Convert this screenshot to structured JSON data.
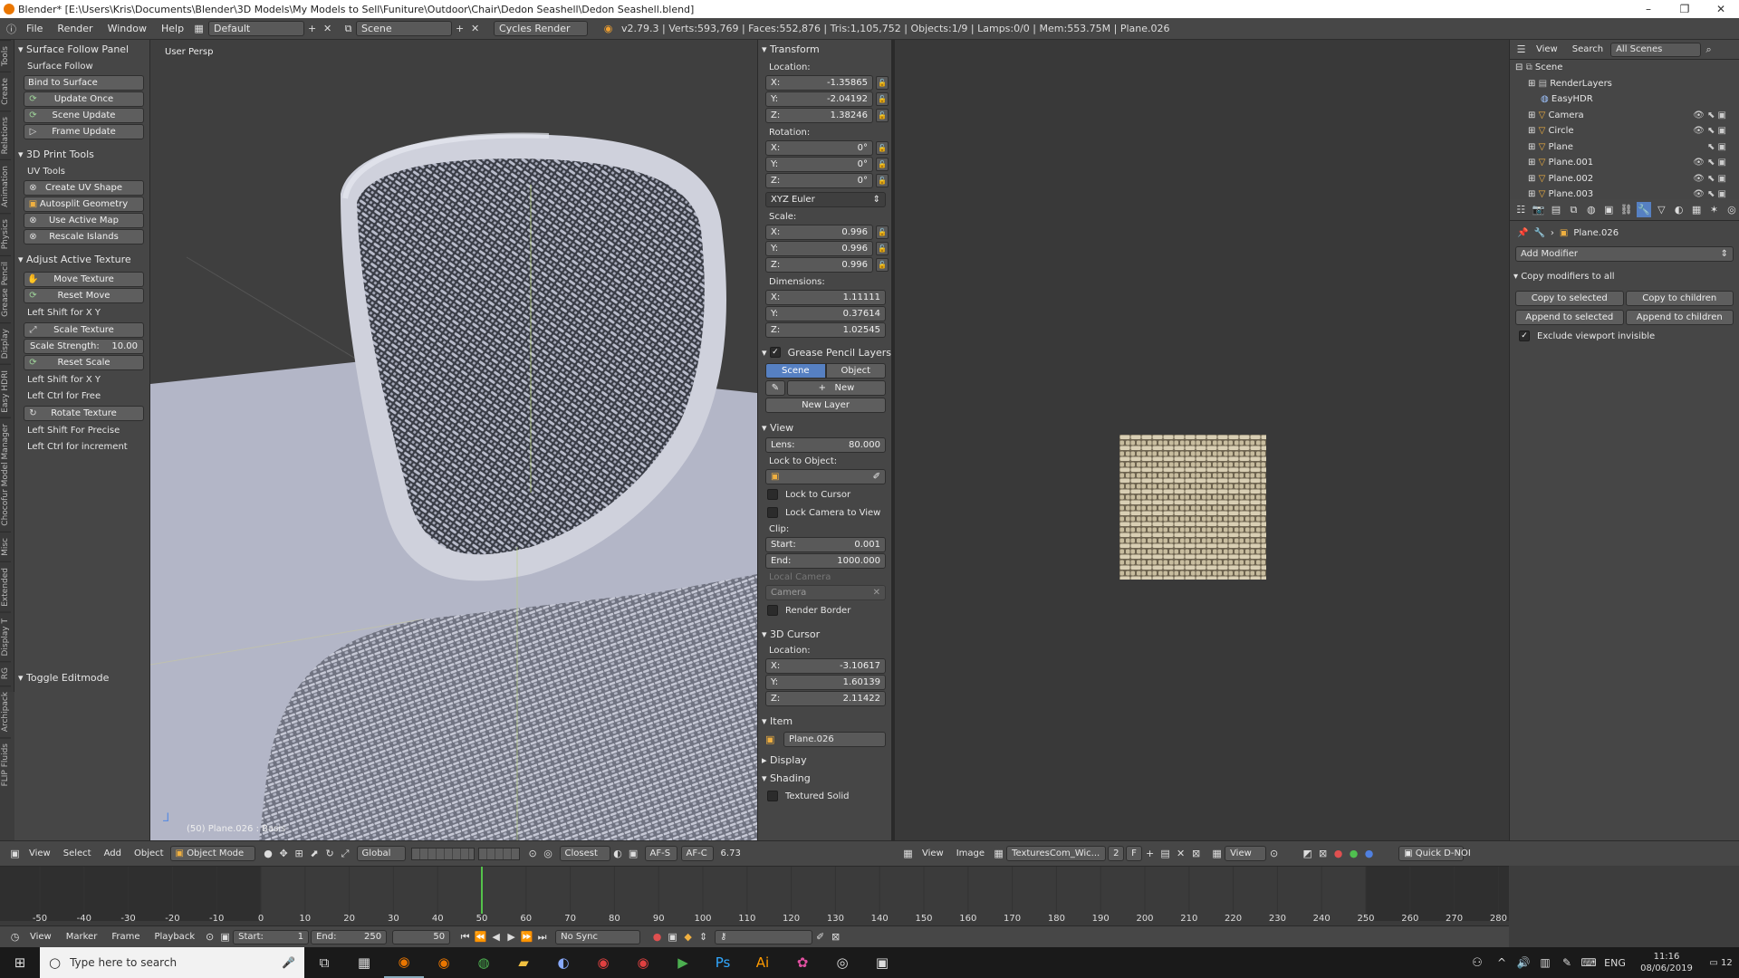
{
  "titlebar": {
    "title": "Blender* [E:\\Users\\Kris\\Documents\\Blender\\3D Models\\My Models to Sell\\Funiture\\Outdoor\\Chair\\Dedon Seashell\\Dedon Seashell.blend]",
    "min": "–",
    "max": "❐",
    "close": "✕"
  },
  "menubar": {
    "items": [
      "File",
      "Render",
      "Window",
      "Help"
    ],
    "layout": "Default",
    "scene": "Scene",
    "engine": "Cycles Render",
    "stats": "v2.79.3 | Verts:593,769 | Faces:552,876 | Tris:1,105,752 | Objects:1/9 | Lamps:0/0 | Mem:553.75M | Plane.026"
  },
  "vtabs": [
    "Tools",
    "Create",
    "Relations",
    "Animation",
    "Physics",
    "Grease Pencil",
    "Display",
    "Easy HDRI",
    "Chocofur Model Manager",
    "Misc",
    "Extended",
    "Display T",
    "RG",
    "Archipack",
    "FLIP Fluids"
  ],
  "toolshelf": {
    "surface_follow": {
      "header": "Surface Follow Panel",
      "label": "Surface Follow",
      "bind": "Bind to Surface",
      "update_once": "Update Once",
      "scene_update": "Scene Update",
      "frame_update": "Frame Update"
    },
    "print3d": {
      "header": "3D Print Tools",
      "uv_label": "UV Tools",
      "create_uv": "Create UV Shape",
      "autosplit": "Autosplit Geometry",
      "use_active_map": "Use Active Map",
      "rescale": "Rescale Islands"
    },
    "adjust": {
      "header": "Adjust Active Texture",
      "move": "Move Texture",
      "reset_move": "Reset Move",
      "hint1": "Left Shift for X Y",
      "scale": "Scale Texture",
      "strength_label": "Scale Strength:",
      "strength_value": "10.00",
      "reset_scale": "Reset Scale",
      "hint2": "Left Shift for X Y",
      "hint3": "Left Ctrl for Free",
      "rotate": "Rotate Texture",
      "hint4": "Left Shift For Precise",
      "hint5": "Left Ctrl for increment"
    },
    "toggle_editmode": "Toggle Editmode"
  },
  "viewport": {
    "label": "User Persp",
    "status": "(50) Plane.026 : Basis"
  },
  "npanel": {
    "transform": {
      "header": "Transform",
      "location_label": "Location:",
      "loc": [
        {
          "k": "X:",
          "v": "-1.35865"
        },
        {
          "k": "Y:",
          "v": "-2.04192"
        },
        {
          "k": "Z:",
          "v": "1.38246"
        }
      ],
      "rotation_label": "Rotation:",
      "rot": [
        {
          "k": "X:",
          "v": "0°"
        },
        {
          "k": "Y:",
          "v": "0°"
        },
        {
          "k": "Z:",
          "v": "0°"
        }
      ],
      "rotmode": "XYZ Euler",
      "scale_label": "Scale:",
      "scale": [
        {
          "k": "X:",
          "v": "0.996"
        },
        {
          "k": "Y:",
          "v": "0.996"
        },
        {
          "k": "Z:",
          "v": "0.996"
        }
      ],
      "dim_label": "Dimensions:",
      "dim": [
        {
          "k": "X:",
          "v": "1.11111"
        },
        {
          "k": "Y:",
          "v": "0.37614"
        },
        {
          "k": "Z:",
          "v": "1.02545"
        }
      ]
    },
    "grease": {
      "header": "Grease Pencil Layers",
      "scene_tab": "Scene",
      "object_tab": "Object",
      "new": "New",
      "new_layer": "New Layer"
    },
    "view": {
      "header": "View",
      "lens_label": "Lens:",
      "lens": "80.000",
      "lock_label": "Lock to Object:",
      "lock_cursor": "Lock to Cursor",
      "lock_camera": "Lock Camera to View",
      "clip_label": "Clip:",
      "start_label": "Start:",
      "start": "0.001",
      "end_label": "End:",
      "end": "1000.000",
      "local_camera": "Local Camera",
      "camera": "Camera",
      "render_border": "Render Border"
    },
    "cursor": {
      "header": "3D Cursor",
      "location_label": "Location:",
      "loc": [
        {
          "k": "X:",
          "v": "-3.10617"
        },
        {
          "k": "Y:",
          "v": "1.60139"
        },
        {
          "k": "Z:",
          "v": "2.11422"
        }
      ]
    },
    "item": {
      "header": "Item",
      "name": "Plane.026"
    },
    "display_header": "Display",
    "shading_header": "Shading",
    "textured_solid": "Textured Solid"
  },
  "outliner": {
    "view": "View",
    "search": "Search",
    "scenes": "All Scenes",
    "rows": [
      {
        "name": "Scene",
        "indent": 0
      },
      {
        "name": "RenderLayers",
        "indent": 1
      },
      {
        "name": "EasyHDR",
        "indent": 1
      },
      {
        "name": "Camera",
        "indent": 1
      },
      {
        "name": "Circle",
        "indent": 1
      },
      {
        "name": "Plane",
        "indent": 1
      },
      {
        "name": "Plane.001",
        "indent": 1
      },
      {
        "name": "Plane.002",
        "indent": 1
      },
      {
        "name": "Plane.003",
        "indent": 1
      }
    ]
  },
  "properties": {
    "object": "Plane.026",
    "add_modifier": "Add Modifier",
    "copy_header": "Copy modifiers to all",
    "copy_selected": "Copy to selected",
    "copy_children": "Copy to children",
    "append_selected": "Append to selected",
    "append_children": "Append to children",
    "exclude": "Exclude viewport invisible"
  },
  "vp_header": {
    "view": "View",
    "select": "Select",
    "add": "Add",
    "object": "Object",
    "mode": "Object Mode",
    "orientation": "Global",
    "snap": "Closest",
    "afs": "AF-S",
    "afc": "AF-C",
    "num": "6.73"
  },
  "img_header": {
    "view": "View",
    "image": "Image",
    "texture": "TexturesCom_Wic...",
    "users": "2",
    "f": "F",
    "view2": "View",
    "quick": "Quick D-NOI"
  },
  "timeline": {
    "ticks": [
      "-50",
      "-40",
      "-30",
      "-20",
      "-10",
      "0",
      "10",
      "20",
      "30",
      "40",
      "50",
      "60",
      "70",
      "80",
      "90",
      "100",
      "110",
      "120",
      "130",
      "140",
      "150",
      "160",
      "170",
      "180",
      "190",
      "200",
      "210",
      "220",
      "230",
      "240",
      "250",
      "260",
      "270",
      "280"
    ],
    "current_frame": 50,
    "range_start": 0,
    "range_end": 250,
    "tick_start": -50,
    "tick_step": 10
  },
  "tl_header": {
    "view": "View",
    "marker": "Marker",
    "frame": "Frame",
    "playback": "Playback",
    "start_label": "Start:",
    "start": "1",
    "end_label": "End:",
    "end": "250",
    "current": "50",
    "sync": "No Sync"
  },
  "taskbar": {
    "search": "Type here to search",
    "lang": "ENG",
    "time": "11:16",
    "date": "08/06/2019",
    "notif": "12"
  }
}
